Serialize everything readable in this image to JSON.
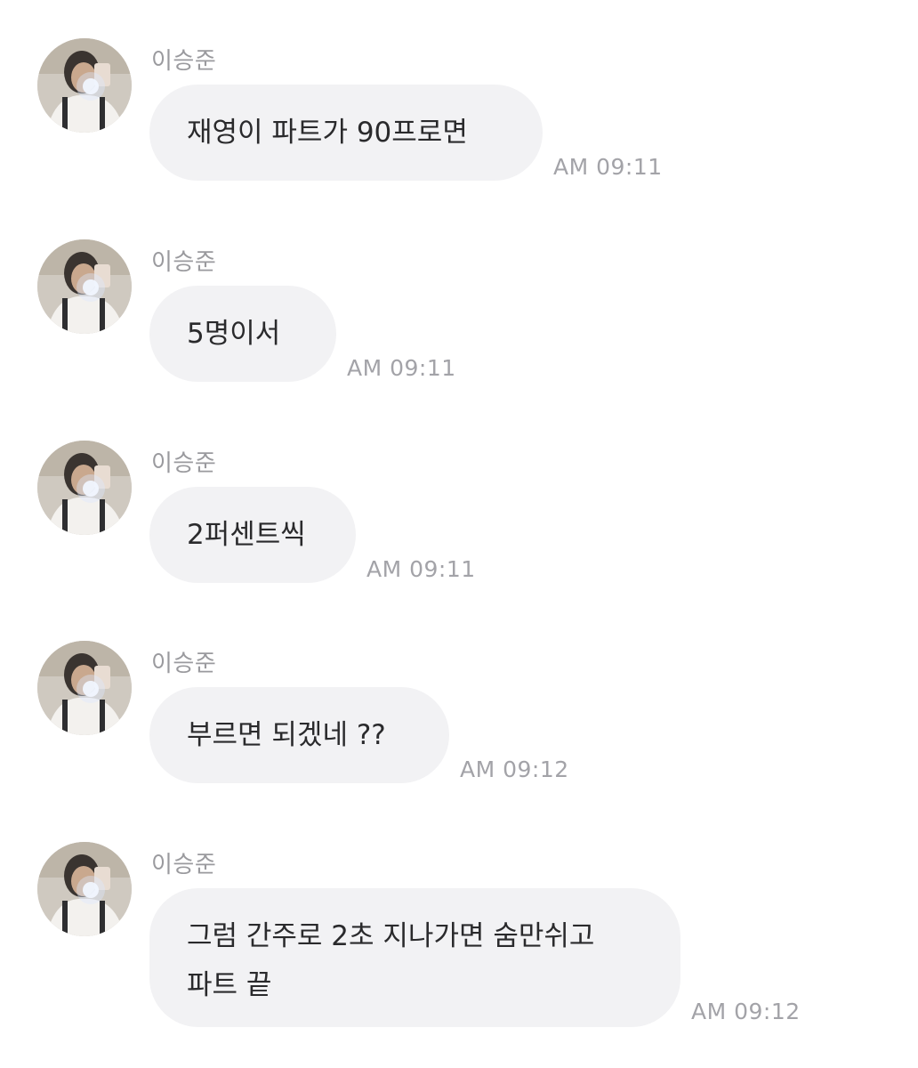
{
  "chat": {
    "messages": [
      {
        "sender": "이승준",
        "text": "재영이 파트가 90프로면",
        "time": "AM 09:11"
      },
      {
        "sender": "이승준",
        "text": "5명이서",
        "time": "AM 09:11"
      },
      {
        "sender": "이승준",
        "text": "2퍼센트씩",
        "time": "AM 09:11"
      },
      {
        "sender": "이승준",
        "text": "부르면 되겠네 ??",
        "time": "AM 09:12"
      },
      {
        "sender": "이승준",
        "text": "그럼 간주로 2초 지나가면 숨만쉬고\n파트 끝",
        "time": "AM 09:12"
      }
    ]
  },
  "colors": {
    "bubble": "#f2f2f4",
    "text": "#2a2a2c",
    "meta": "#9a9a9e"
  }
}
